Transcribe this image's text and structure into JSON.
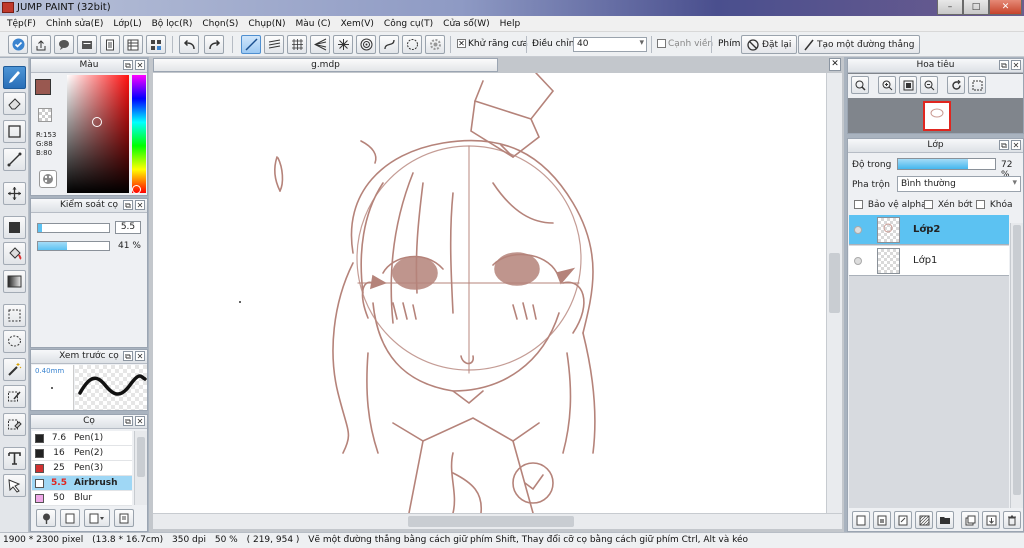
{
  "window": {
    "title": "JUMP PAINT (32bit)",
    "minimize": "–",
    "maximize": "□",
    "close": "✕"
  },
  "menu": [
    "Tệp(F)",
    "Chỉnh sửa(E)",
    "Lớp(L)",
    "Bộ lọc(R)",
    "Chọn(S)",
    "Chụp(N)",
    "Màu (C)",
    "Xem(V)",
    "Công cụ(T)",
    "Cửa sổ(W)",
    "Help"
  ],
  "toolbar": {
    "antialias_label": "Khử răng cưa",
    "antialias_checked": true,
    "adjust_label": "Điều chỉnh",
    "adjust_value": "40",
    "range_label": "Cạnh viền",
    "key_label": "Phím",
    "reset_label": "Đặt lại",
    "straight_line_label": "Tạo một đường thẳng"
  },
  "color_panel": {
    "title": "Màu",
    "r": "R:153",
    "g": "G:88",
    "b": "B:80",
    "primary_color": "#995850",
    "secondary_color": "#000000"
  },
  "brush_control_panel": {
    "title": "Kiểm soát cọ",
    "size_value": "5.5",
    "opacity_value": "41 %",
    "opacity_fraction": 0.41
  },
  "brush_preview_panel": {
    "title": "Xem trước cọ",
    "size_text": "0.40mm"
  },
  "brush_panel": {
    "title": "Cọ",
    "items": [
      {
        "size": "7.6",
        "name": "Pen(1)",
        "color": "#222222",
        "selected": false
      },
      {
        "size": "16",
        "name": "Pen(2)",
        "color": "#222222",
        "selected": false
      },
      {
        "size": "25",
        "name": "Pen(3)",
        "color": "#d23030",
        "selected": false
      },
      {
        "size": "5.5",
        "name": "Airbrush",
        "color": "#ffffff",
        "selected": true
      },
      {
        "size": "50",
        "name": "Blur",
        "color": "#f0a8e8",
        "selected": false
      }
    ]
  },
  "document": {
    "tab_title": "g.mdp",
    "sketch_color": "#b5837a"
  },
  "navigator_panel": {
    "title": "Hoa tiêu"
  },
  "layer_panel": {
    "title": "Lớp",
    "opacity_label": "Độ trong",
    "opacity_value": "72 %",
    "opacity_fraction": 0.72,
    "blend_label": "Pha trộn",
    "blend_value": "Bình thường",
    "protect_alpha_label": "Bảo vệ alpha",
    "clip_label": "Xén bớt",
    "lock_label": "Khóa",
    "layers": [
      {
        "name": "Lớp2",
        "selected": true
      },
      {
        "name": "Lớp1",
        "selected": false
      }
    ]
  },
  "status": {
    "size": "1900 * 2300 pixel",
    "physical": "(13.8 * 16.7cm)",
    "dpi": "350 dpi",
    "zoom": "50 %",
    "coords": "( 219, 954 )",
    "hint": "Vẽ một đường thẳng bằng cách giữ phím Shift, Thay đổi cỡ cọ bằng cách giữ phím Ctrl, Alt và kéo"
  },
  "accent_color": "#5cc2f2"
}
